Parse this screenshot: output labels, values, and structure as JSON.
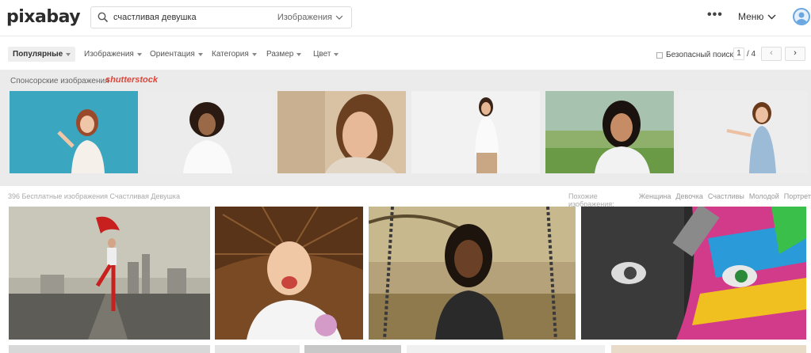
{
  "header": {
    "logo": "pixabay",
    "search_value": "счастливая девушка",
    "search_type": "Изображения",
    "more": "•••",
    "menu_label": "Меню"
  },
  "filters": {
    "items": [
      "Популярные",
      "Изображения",
      "Ориентация",
      "Категория",
      "Размер",
      "Цвет"
    ],
    "safe_search": "Безопасный поиск",
    "page_current": "1",
    "page_total": "/ 4",
    "prev": "‹",
    "next": "›"
  },
  "sponsored": {
    "label": "Спонсорские изображения",
    "brand": "shutterstock"
  },
  "results": {
    "count_text": "396 Бесплатные изображения Счастливая Девушка",
    "related_label": "Похожие изображения:",
    "related": [
      "Женщина",
      "Девочка",
      "Счастливы",
      "Молодой",
      "Портрет"
    ]
  },
  "colors": {
    "accent": "#e0453a",
    "avatar": "#6aa7e0"
  }
}
